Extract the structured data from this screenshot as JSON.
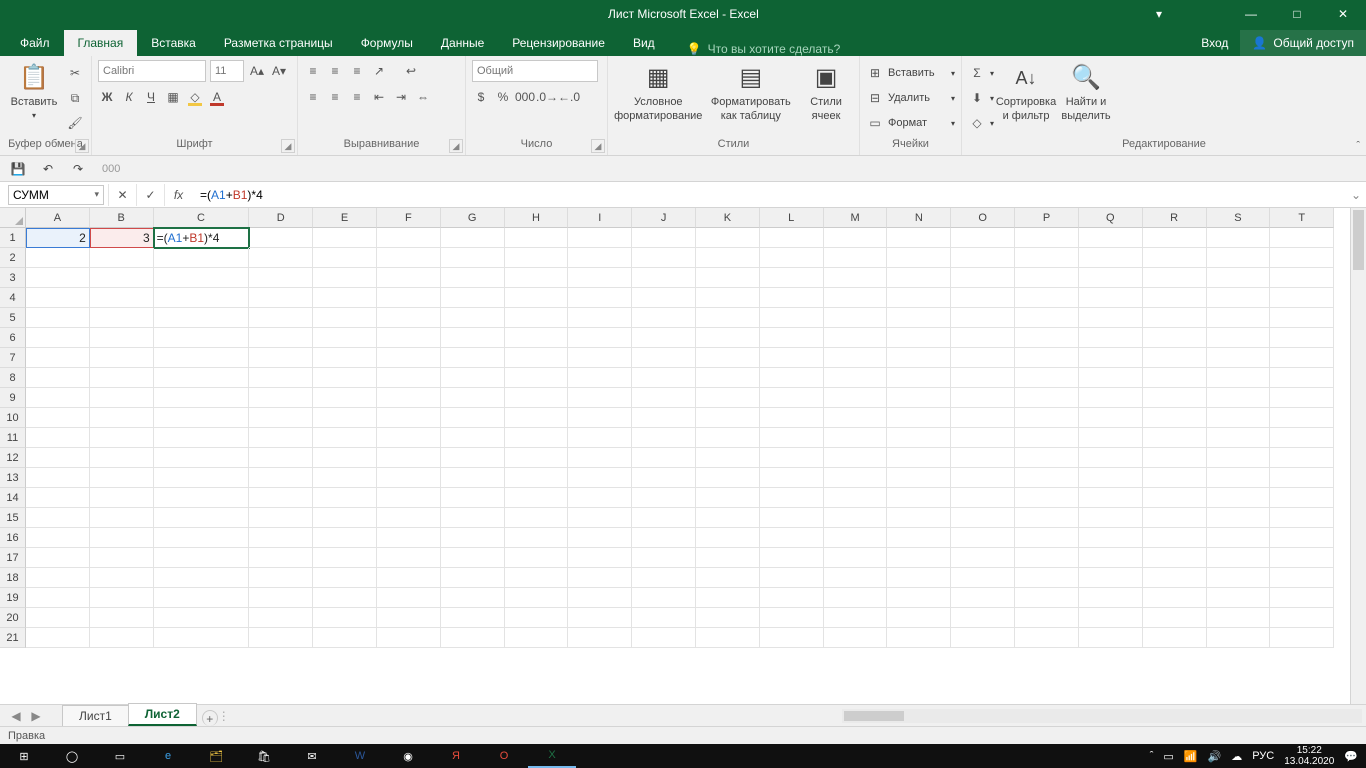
{
  "titlebar": {
    "title": "Лист Microsoft Excel - Excel"
  },
  "tabs": {
    "file": "Файл",
    "list": [
      "Главная",
      "Вставка",
      "Разметка страницы",
      "Формулы",
      "Данные",
      "Рецензирование",
      "Вид"
    ],
    "active": "Главная",
    "tellme": "Что вы хотите сделать?",
    "signin": "Вход",
    "share": "Общий доступ"
  },
  "ribbon": {
    "clipboard": {
      "paste": "Вставить",
      "label": "Буфер обмена"
    },
    "font": {
      "name": "Calibri",
      "size": "11",
      "label": "Шрифт",
      "letters": [
        "Ж",
        "К",
        "Ч"
      ]
    },
    "alignment": {
      "label": "Выравнивание"
    },
    "number": {
      "format": "Общий",
      "label": "Число"
    },
    "styles": {
      "cond1": "Условное",
      "cond2": "форматирование",
      "fmt1": "Форматировать",
      "fmt2": "как таблицу",
      "cell1": "Стили",
      "cell2": "ячеек",
      "label": "Стили"
    },
    "cells": {
      "ins": "Вставить",
      "del": "Удалить",
      "fmt": "Формат",
      "label": "Ячейки"
    },
    "editing": {
      "sort1": "Сортировка",
      "sort2": "и фильтр",
      "find1": "Найти и",
      "find2": "выделить",
      "label": "Редактирование"
    }
  },
  "qat": {
    "placeholder": "000"
  },
  "formulaBar": {
    "nameBox": "СУММ",
    "formula_prefix": "=(",
    "ref1": "A1",
    "plus": "+",
    "ref2": "B1",
    "formula_suffix": ")*4",
    "full": "=(A1+B1)*4"
  },
  "grid": {
    "columns": [
      "A",
      "B",
      "C",
      "D",
      "E",
      "F",
      "G",
      "H",
      "I",
      "J",
      "K",
      "L",
      "M",
      "N",
      "O",
      "P",
      "Q",
      "R",
      "S",
      "T"
    ],
    "rows": 21,
    "cells": {
      "A1": "2",
      "B1": "3",
      "C1_prefix": "=(",
      "C1_ref1": "A1",
      "C1_plus": "+",
      "C1_ref2": "B1",
      "C1_suffix": ")*4"
    }
  },
  "sheets": {
    "list": [
      "Лист1",
      "Лист2"
    ],
    "active": "Лист2"
  },
  "status": {
    "mode": "Правка"
  },
  "taskbar": {
    "lang": "РУС",
    "time": "15:22",
    "date": "13.04.2020"
  }
}
